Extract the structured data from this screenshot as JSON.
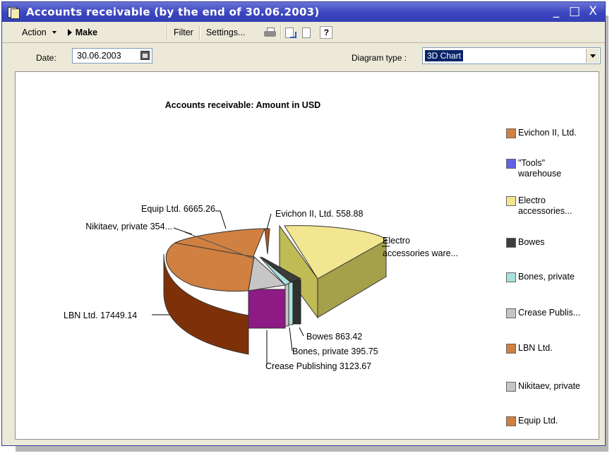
{
  "window": {
    "title": "Accounts receivable (by the end of 30.06.2003)",
    "controls": {
      "minimize": "_",
      "maximize": "□",
      "close": "X"
    }
  },
  "toolbar": {
    "action_label": "Action",
    "make_label": "Make",
    "filter_label": "Filter",
    "settings_label": "Settings...",
    "help_label": "?"
  },
  "filters": {
    "date_label": "Date:",
    "date_value": "30.06.2003",
    "diagram_type_label": "Diagram type :",
    "diagram_type_value": "3D Chart"
  },
  "colors": {
    "titlebar": "#3b45c0",
    "evichon": "#d08040",
    "tools": "#5f63e6",
    "electro": "#f3e690",
    "bowes": "#3d3d3d",
    "bones": "#a8e2dd",
    "crease": "#c6c6c6",
    "lbn": "#d08040",
    "nikitaev": "#c6c6c6",
    "equip": "#d08040",
    "crease_front": "#8e1a86"
  },
  "chart_data": {
    "type": "pie",
    "title": "Accounts receivable: Amount in USD",
    "slices": [
      {
        "name": "Evichon II, Ltd.",
        "value": 558.88,
        "label": "Evichon II, Ltd.   558.88"
      },
      {
        "name": "\"Tools\" warehouse",
        "value": 0
      },
      {
        "name": "Electro accessories ware...",
        "value": 22340,
        "label_1": "Electro",
        "label_2": "accessories ware..."
      },
      {
        "name": "Bowes",
        "value": 863.42,
        "label": "Bowes 863.42"
      },
      {
        "name": "Bones, private",
        "value": 395.75,
        "label": "Bones, private  395.75"
      },
      {
        "name": "Crease Publishing",
        "value": 3123.67,
        "label": "Crease Publishing 3123.67"
      },
      {
        "name": "LBN Ltd.",
        "value": 17449.14,
        "label": "LBN Ltd. 17449.14"
      },
      {
        "name": "Nikitaev, private",
        "value": 354,
        "label": "Nikitaev, private  354..."
      },
      {
        "name": "Equip Ltd.",
        "value": 6665.26,
        "label": "Equip Ltd.  6665.26"
      }
    ],
    "legend": [
      {
        "lines": [
          "Evichon II, Ltd."
        ],
        "color": "#d08040"
      },
      {
        "lines": [
          "\"Tools\"",
          "warehouse"
        ],
        "color": "#5f63e6"
      },
      {
        "lines": [
          "Electro",
          "accessories..."
        ],
        "color": "#f3e690"
      },
      {
        "lines": [
          "Bowes"
        ],
        "color": "#3d3d3d"
      },
      {
        "lines": [
          "Bones, private"
        ],
        "color": "#a8e2dd"
      },
      {
        "lines": [
          "Crease Publis..."
        ],
        "color": "#c6c6c6"
      },
      {
        "lines": [
          "LBN Ltd."
        ],
        "color": "#d08040"
      },
      {
        "lines": [
          "Nikitaev, private"
        ],
        "color": "#c6c6c6"
      },
      {
        "lines": [
          "Equip Ltd."
        ],
        "color": "#d08040"
      }
    ],
    "legend_position": "right"
  }
}
